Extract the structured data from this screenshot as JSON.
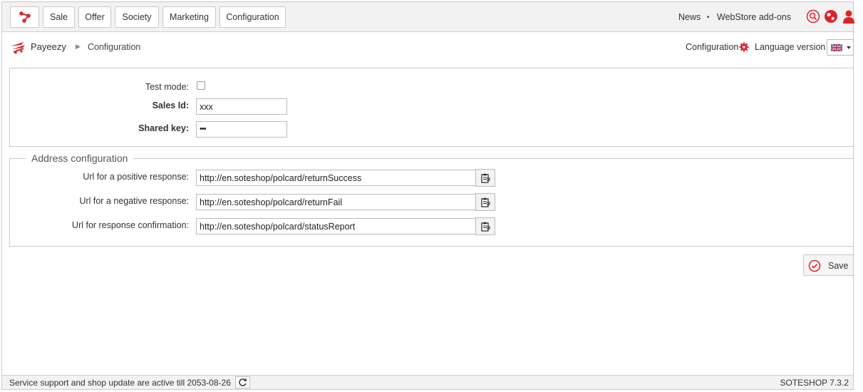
{
  "nav": {
    "items": [
      {
        "label": "Sale"
      },
      {
        "label": "Offer"
      },
      {
        "label": "Society"
      },
      {
        "label": "Marketing"
      },
      {
        "label": "Configuration"
      }
    ],
    "news": "News",
    "separator": "•",
    "addons": "WebStore add-ons",
    "icons": [
      "search-icon",
      "globe-icon",
      "user-icon"
    ]
  },
  "breadcrumb": {
    "app": "Payeezy",
    "separator": "▶",
    "current": "Configuration"
  },
  "header_right": {
    "config_label": "Configuration",
    "language_label": "Language version",
    "language_flag": "uk-flag-icon"
  },
  "form": {
    "test_mode_label": "Test mode:",
    "test_mode_checked": false,
    "sales_id_label": "Sales Id:",
    "sales_id_value": "xxx",
    "shared_key_label": "Shared key:",
    "shared_key_display": "•••"
  },
  "address": {
    "legend": "Address configuration",
    "rows": [
      {
        "label": "Url for a positive response:",
        "value": "http://en.soteshop/polcard/returnSuccess"
      },
      {
        "label": "Url for a negative response:",
        "value": "http://en.soteshop/polcard/returnFail"
      },
      {
        "label": "Url for response confirmation:",
        "value": "http://en.soteshop/polcard/statusReport"
      }
    ]
  },
  "actions": {
    "save_label": "Save"
  },
  "footer": {
    "status": "Service support and shop update are active till 2053-08-26",
    "version": "SOTESHOP 7.3.2"
  },
  "colors": {
    "accent": "#d9262b",
    "topbar_bg": "#f2f2f2",
    "border": "#c9c9c9"
  }
}
